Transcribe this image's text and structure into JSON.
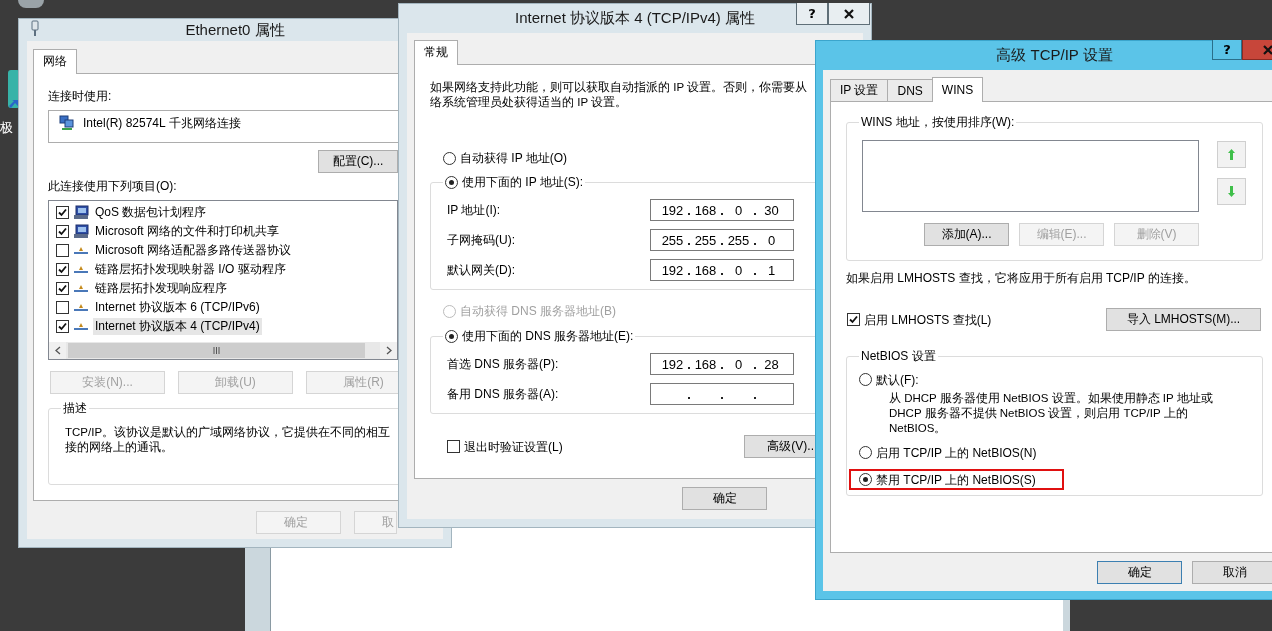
{
  "desktop": {
    "icon_label": "极"
  },
  "ethernet_properties": {
    "title": "Ethernet0 属性",
    "tabs": [
      {
        "label": "网络",
        "selected": true
      }
    ],
    "connect_using_label": "连接时使用:",
    "adapter": "Intel(R) 82574L 千兆网络连接",
    "configure_button": "配置(C)...",
    "items_label": "此连接使用下列项目(O):",
    "items": [
      {
        "kind": "service",
        "label": "QoS 数据包计划程序",
        "checked": true,
        "selected": false
      },
      {
        "kind": "service",
        "label": "Microsoft 网络的文件和打印机共享",
        "checked": true,
        "selected": false
      },
      {
        "kind": "protocol",
        "label": "Microsoft 网络适配器多路传送器协议",
        "checked": false,
        "selected": false
      },
      {
        "kind": "protocol",
        "label": "链路层拓扑发现映射器 I/O 驱动程序",
        "checked": true,
        "selected": false
      },
      {
        "kind": "protocol",
        "label": "链路层拓扑发现响应程序",
        "checked": true,
        "selected": false
      },
      {
        "kind": "protocol",
        "label": "Internet 协议版本 6 (TCP/IPv6)",
        "checked": false,
        "selected": false
      },
      {
        "kind": "protocol",
        "label": "Internet 协议版本 4 (TCP/IPv4)",
        "checked": true,
        "selected": true
      }
    ],
    "item_buttons": [
      {
        "label": "安装(N)...",
        "disabled": true
      },
      {
        "label": "卸载(U)",
        "disabled": true
      },
      {
        "label": "属性(R)",
        "disabled": true
      }
    ],
    "description": {
      "title": "描述",
      "lines": [
        "TCP/IP。该协议是默认的广域网络协议，它提供在不同的相互",
        "接的网络上的通讯。"
      ]
    },
    "buttons": [
      {
        "label": "确定",
        "disabled": true
      },
      {
        "label": "取",
        "disabled": true
      }
    ]
  },
  "ipv4_properties": {
    "title": "Internet 协议版本 4 (TCP/IPv4) 属性",
    "help_button": "?",
    "tabs": [
      {
        "label": "常规",
        "selected": true
      }
    ],
    "intro_lines": [
      "如果网络支持此功能，则可以获取自动指派的 IP 设置。否则，你需要从",
      "络系统管理员处获得适当的 IP 设置。"
    ],
    "ip_mode": [
      {
        "label": "自动获得 IP 地址(O)",
        "selected": false,
        "disabled": false
      },
      {
        "label": "使用下面的 IP 地址(S):",
        "selected": true,
        "disabled": false
      }
    ],
    "ip_fields": [
      {
        "label": "IP 地址(I):",
        "octets": [
          "192",
          "168",
          "0",
          "30"
        ]
      },
      {
        "label": "子网掩码(U):",
        "octets": [
          "255",
          "255",
          "255",
          "0"
        ]
      },
      {
        "label": "默认网关(D):",
        "octets": [
          "192",
          "168",
          "0",
          "1"
        ]
      }
    ],
    "dns_mode": [
      {
        "label": "自动获得 DNS 服务器地址(B)",
        "selected": false,
        "disabled": true
      },
      {
        "label": "使用下面的 DNS 服务器地址(E):",
        "selected": true,
        "disabled": false
      }
    ],
    "dns_fields": [
      {
        "label": "首选 DNS 服务器(P):",
        "octets": [
          "192",
          "168",
          "0",
          "28"
        ]
      },
      {
        "label": "备用 DNS 服务器(A):"
      }
    ],
    "validate_checkbox": {
      "label": "退出时验证设置(L)",
      "checked": false
    },
    "advanced_button": "高级(V)..",
    "buttons": [
      {
        "label": "确定",
        "disabled": false
      }
    ]
  },
  "advanced_tcpip": {
    "title": "高级 TCP/IP 设置",
    "help_button": "?",
    "tabs": [
      {
        "label": "IP 设置",
        "selected": false
      },
      {
        "label": "DNS",
        "selected": false
      },
      {
        "label": "WINS",
        "selected": true
      }
    ],
    "wins_group": "WINS 地址，按使用排序(W):",
    "wins_buttons": [
      {
        "label": "添加(A)...",
        "disabled": false
      },
      {
        "label": "编辑(E)...",
        "disabled": true
      },
      {
        "label": "删除(V)",
        "disabled": true
      }
    ],
    "lmhosts_note": "如果启用 LMHOSTS 查找，它将应用于所有启用 TCP/IP 的连接。",
    "lmhosts_checkbox": {
      "label": "启用 LMHOSTS 查找(L)",
      "checked": true
    },
    "import_button": "导入 LMHOSTS(M)...",
    "netbios": {
      "title": "NetBIOS 设置",
      "options": [
        {
          "label": "默认(F):",
          "selected": false,
          "highlighted": false,
          "detail_lines": [
            "从 DHCP 服务器使用 NetBIOS 设置。如果使用静态 IP 地址或",
            "DHCP 服务器不提供 NetBIOS 设置，则启用 TCP/IP 上的",
            "NetBIOS。"
          ]
        },
        {
          "label": "启用 TCP/IP 上的 NetBIOS(N)",
          "selected": false,
          "highlighted": false
        },
        {
          "label": "禁用 TCP/IP 上的 NetBIOS(S)",
          "selected": true,
          "highlighted": true
        }
      ]
    },
    "buttons": [
      {
        "label": "确定",
        "disabled": false
      },
      {
        "label": "取消",
        "disabled": false
      }
    ]
  }
}
